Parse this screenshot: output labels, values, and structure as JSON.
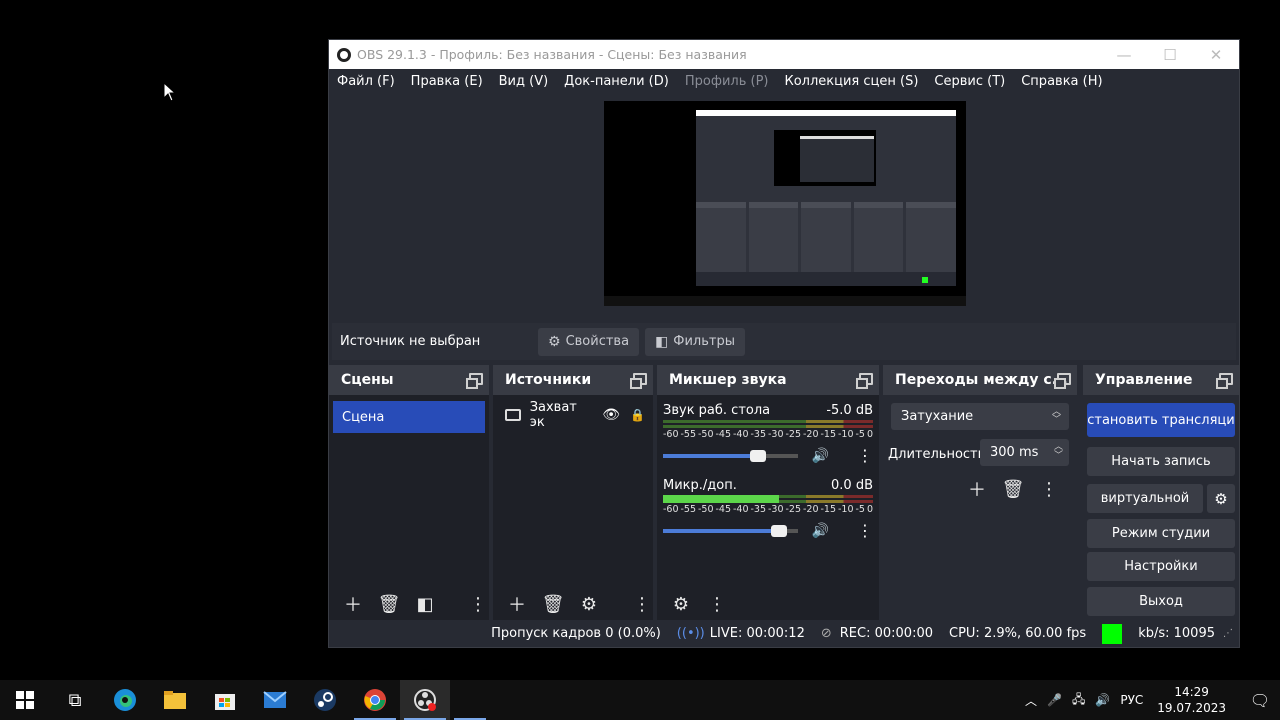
{
  "window": {
    "title": "OBS 29.1.3 - Профиль: Без названия - Сцены: Без названия",
    "minimize": "—",
    "maximize": "☐",
    "close": "✕"
  },
  "menu": {
    "file": "Файл (F)",
    "edit": "Правка (E)",
    "view": "Вид (V)",
    "docks": "Док-панели (D)",
    "profile": "Профиль (P)",
    "collection": "Коллекция сцен (S)",
    "tools": "Сервис (T)",
    "help": "Справка (H)"
  },
  "source_toolbar": {
    "no_source": "Источник не выбран",
    "properties": "Свойства",
    "filters": "Фильтры"
  },
  "scenes": {
    "title": "Сцены",
    "items": [
      "Сцена"
    ]
  },
  "sources": {
    "title": "Источники",
    "items": [
      "Захват эк"
    ]
  },
  "mixer": {
    "title": "Микшер звука",
    "channels": [
      {
        "name": "Звук раб. стола",
        "db": "-5.0 dB",
        "level": 0.0,
        "volume": 0.68
      },
      {
        "name": "Микр./доп.",
        "db": "0.0 dB",
        "level": 0.55,
        "volume": 0.83
      }
    ],
    "scale": [
      "-60",
      "-55",
      "-50",
      "-45",
      "-40",
      "-35",
      "-30",
      "-25",
      "-20",
      "-15",
      "-10",
      "-5",
      "0"
    ]
  },
  "transitions": {
    "title": "Переходы между с...",
    "selected": "Затухание",
    "duration_label": "Длительность",
    "duration_value": "300 ms"
  },
  "controls": {
    "title": "Управление",
    "stop_stream": "становить трансляци",
    "start_record": "Начать запись",
    "virtual_cam": "виртуальной",
    "studio_mode": "Режим студии",
    "settings": "Настройки",
    "exit": "Выход"
  },
  "status": {
    "dropped": "Пропуск кадров 0 (0.0%)",
    "live": "LIVE: 00:00:12",
    "rec": "REC: 00:00:00",
    "cpu": "CPU: 2.9%, 60.00 fps",
    "kbs": "kb/s: 10095",
    "health_color": "#00ff00"
  },
  "taskbar": {
    "lang": "РУС",
    "time": "14:29",
    "date": "19.07.2023"
  },
  "colors": {
    "accent": "#284cb8",
    "bg": "#272a33"
  }
}
